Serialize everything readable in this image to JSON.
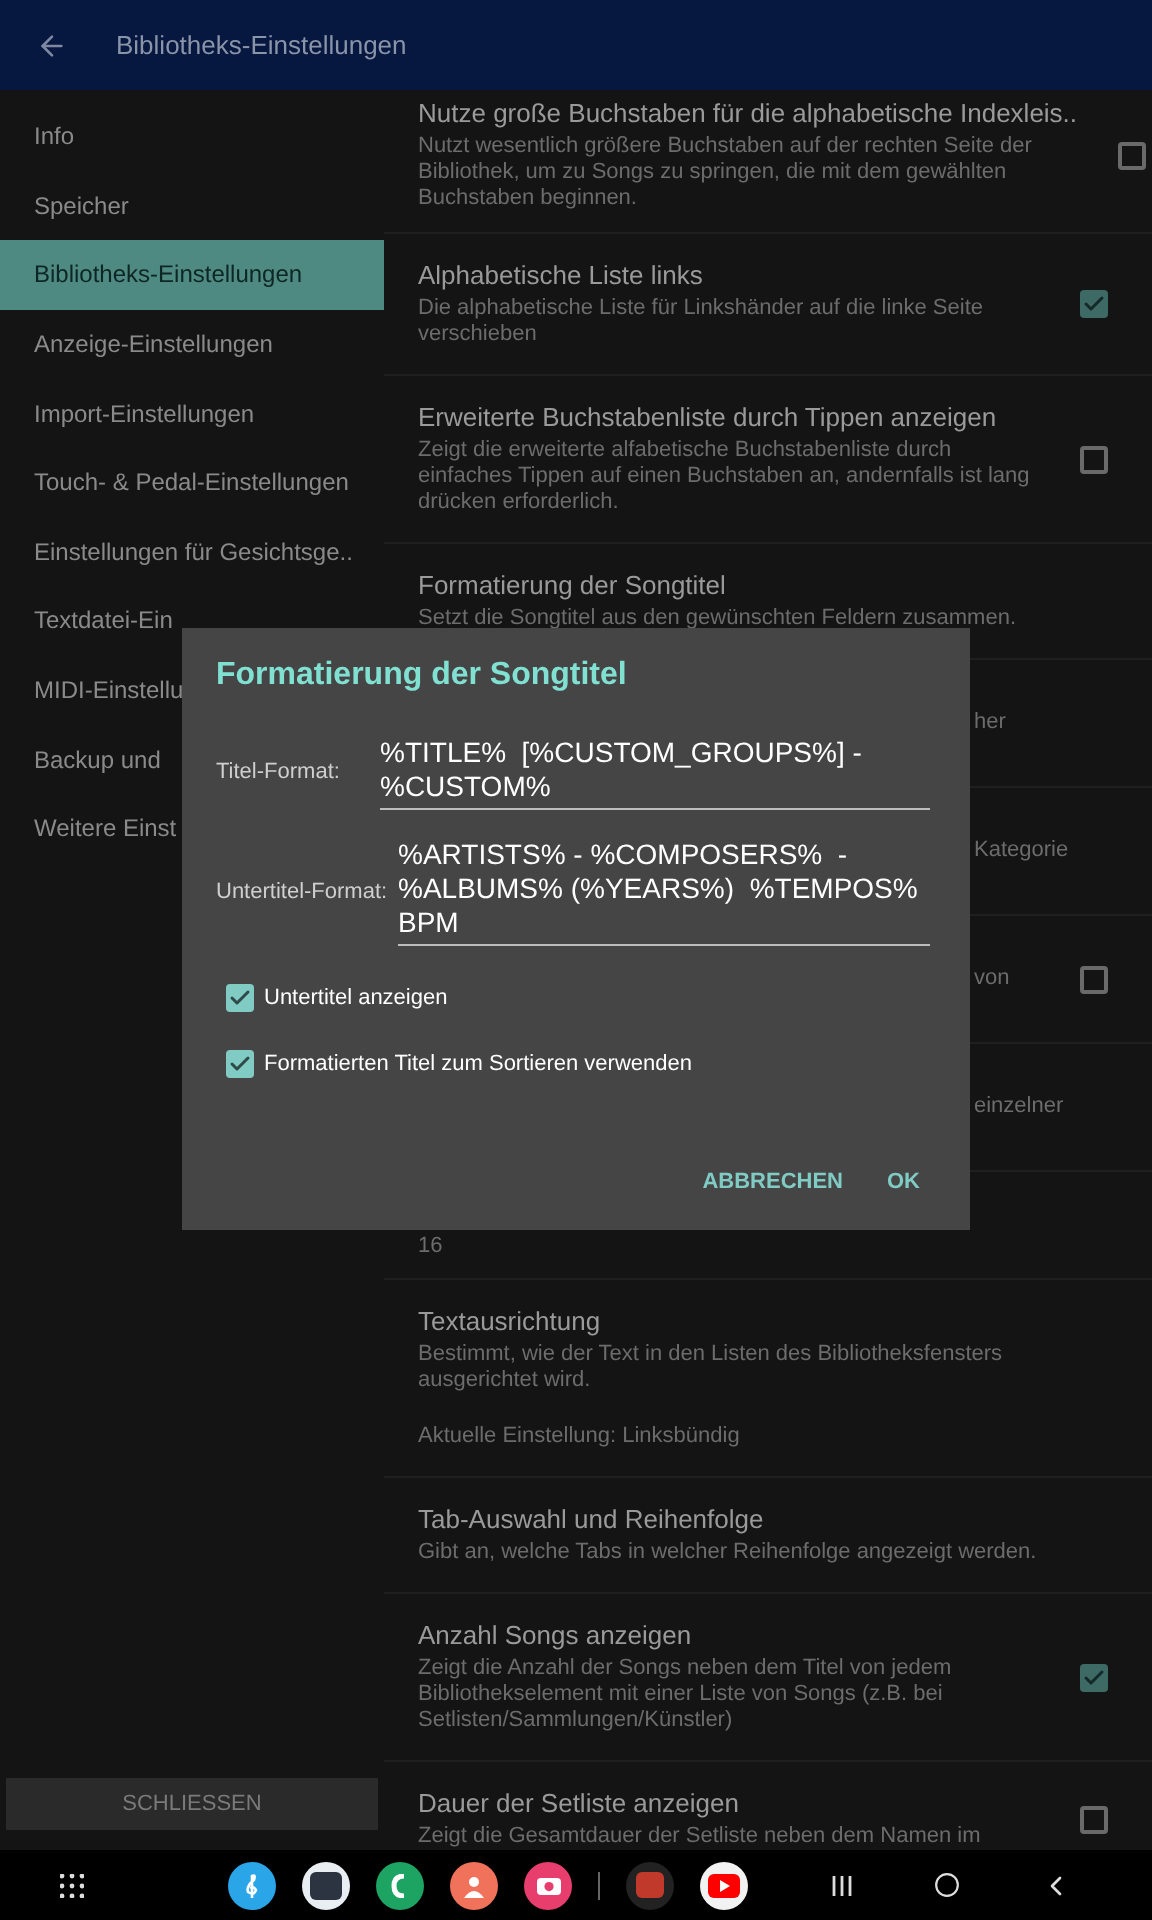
{
  "header": {
    "title": "Bibliotheks-Einstellungen"
  },
  "sidebar": {
    "items": [
      {
        "label": "Info",
        "selected": false
      },
      {
        "label": "Speicher",
        "selected": false
      },
      {
        "label": "Bibliotheks-Einstellungen",
        "selected": true
      },
      {
        "label": "Anzeige-Einstellungen",
        "selected": false
      },
      {
        "label": "Import-Einstellungen",
        "selected": false
      },
      {
        "label": "Touch- & Pedal-Einstellungen",
        "selected": false
      },
      {
        "label": "Einstellungen für Gesichtsge..",
        "selected": false
      },
      {
        "label": "Textdatei-Ein",
        "selected": false
      },
      {
        "label": "MIDI-Einstellu",
        "selected": false
      },
      {
        "label": "Backup und",
        "selected": false
      },
      {
        "label": "Weitere Einst",
        "selected": false
      }
    ],
    "close_button": "SCHLIESSEN"
  },
  "settings": [
    {
      "kind": "checkbox",
      "title": "Nutze große Buchstaben für die alphabetische Indexleis..",
      "description": "Nutzt wesentlich größere Buchstaben auf der rechten Seite der Bibliothek, um zu Songs zu springen, die mit dem gewählten Buchstaben beginnen.",
      "checked": false
    },
    {
      "kind": "checkbox",
      "title": "Alphabetische Liste links",
      "description": "Die alphabetische Liste für Linkshänder auf die linke Seite verschieben",
      "checked": true
    },
    {
      "kind": "checkbox",
      "title": "Erweiterte Buchstabenliste durch Tippen anzeigen",
      "description": "Zeigt die erweiterte alfabetische Buchstabenliste durch einfaches Tippen auf einen Buchstaben an, andernfalls ist lang drücken erforderlich.",
      "checked": false
    },
    {
      "kind": "plain",
      "title": "Formatierung der Songtitel",
      "description": "Setzt die Songtitel aus den gewünschten Feldern zusammen."
    },
    {
      "kind": "fragment",
      "text": "her"
    },
    {
      "kind": "fragment",
      "text": "Kategorie"
    },
    {
      "kind": "fragment",
      "text": "von",
      "checked": false
    },
    {
      "kind": "fragment",
      "text": "einzelner"
    },
    {
      "kind": "value",
      "value": "16"
    },
    {
      "kind": "plain",
      "title": "Textausrichtung",
      "description": "Bestimmt, wie der Text in den Listen des Bibliotheksfensters ausgerichtet wird.",
      "value": "Aktuelle Einstellung: Linksbündig"
    },
    {
      "kind": "plain",
      "title": "Tab-Auswahl und Reihenfolge",
      "description": "Gibt an, welche Tabs in welcher Reihenfolge angezeigt werden."
    },
    {
      "kind": "checkbox",
      "title": "Anzahl Songs anzeigen",
      "description": "Zeigt die Anzahl der Songs neben dem Titel von jedem Bibliothekselement mit einer Liste von Songs (z.B. bei Setlisten/Sammlungen/Künstler)",
      "checked": true
    },
    {
      "kind": "checkbox",
      "title": "Dauer der Setliste anzeigen",
      "description": "Zeigt die Gesamtdauer der Setliste neben dem Namen im",
      "checked": false
    }
  ],
  "dialog": {
    "title": "Formatierung der Songtitel",
    "fields": [
      {
        "label": "Titel-Format:",
        "value": "%TITLE%  [%CUSTOM_GROUPS%] - %CUSTOM%"
      },
      {
        "label": "Untertitel-Format:",
        "value": "%ARTISTS% - %COMPOSERS%  - %ALBUMS% (%YEARS%)  %TEMPOS% BPM"
      }
    ],
    "checkboxes": [
      {
        "label": "Untertitel anzeigen",
        "checked": true
      },
      {
        "label": "Formatierten Titel zum Sortieren verwenden",
        "checked": true
      }
    ],
    "buttons": [
      "ABBRECHEN",
      "OK"
    ]
  }
}
